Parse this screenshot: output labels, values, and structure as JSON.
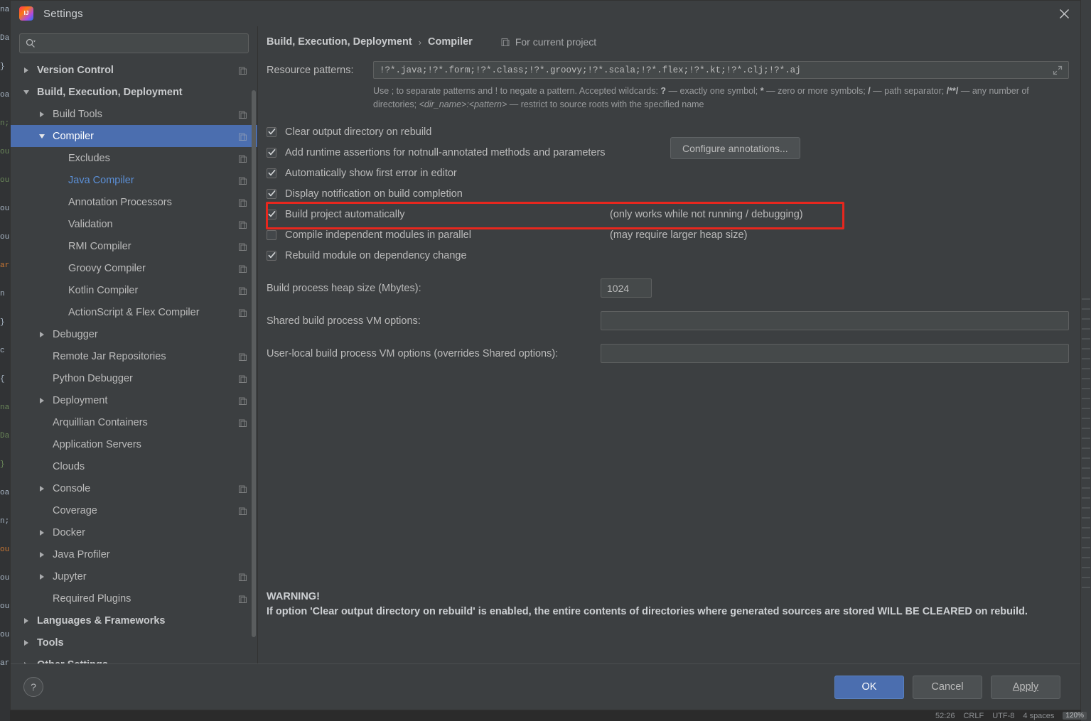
{
  "window": {
    "title": "Settings",
    "app_icon": "intellij-idea-icon",
    "close_icon": "close-icon"
  },
  "search": {
    "value": "",
    "placeholder": "",
    "icon": "search-icon"
  },
  "sidebar": {
    "scrollbar": "vertical-scrollbar",
    "items": [
      {
        "label": "Version Control",
        "level": 0,
        "twisty": "right",
        "bold": true,
        "selected": false,
        "link": false,
        "badge": true
      },
      {
        "label": "Build, Execution, Deployment",
        "level": 0,
        "twisty": "down",
        "bold": true,
        "selected": false,
        "link": false,
        "badge": false
      },
      {
        "label": "Build Tools",
        "level": 1,
        "twisty": "right",
        "bold": false,
        "selected": false,
        "link": false,
        "badge": true
      },
      {
        "label": "Compiler",
        "level": 1,
        "twisty": "down",
        "bold": false,
        "selected": true,
        "link": false,
        "badge": true
      },
      {
        "label": "Excludes",
        "level": 2,
        "twisty": "none",
        "bold": false,
        "selected": false,
        "link": false,
        "badge": true
      },
      {
        "label": "Java Compiler",
        "level": 2,
        "twisty": "none",
        "bold": false,
        "selected": false,
        "link": true,
        "badge": true
      },
      {
        "label": "Annotation Processors",
        "level": 2,
        "twisty": "none",
        "bold": false,
        "selected": false,
        "link": false,
        "badge": true
      },
      {
        "label": "Validation",
        "level": 2,
        "twisty": "none",
        "bold": false,
        "selected": false,
        "link": false,
        "badge": true
      },
      {
        "label": "RMI Compiler",
        "level": 2,
        "twisty": "none",
        "bold": false,
        "selected": false,
        "link": false,
        "badge": true
      },
      {
        "label": "Groovy Compiler",
        "level": 2,
        "twisty": "none",
        "bold": false,
        "selected": false,
        "link": false,
        "badge": true
      },
      {
        "label": "Kotlin Compiler",
        "level": 2,
        "twisty": "none",
        "bold": false,
        "selected": false,
        "link": false,
        "badge": true
      },
      {
        "label": "ActionScript & Flex Compiler",
        "level": 2,
        "twisty": "none",
        "bold": false,
        "selected": false,
        "link": false,
        "badge": true
      },
      {
        "label": "Debugger",
        "level": 1,
        "twisty": "right",
        "bold": false,
        "selected": false,
        "link": false,
        "badge": false
      },
      {
        "label": "Remote Jar Repositories",
        "level": 1,
        "twisty": "none",
        "bold": false,
        "selected": false,
        "link": false,
        "badge": true
      },
      {
        "label": "Python Debugger",
        "level": 1,
        "twisty": "none",
        "bold": false,
        "selected": false,
        "link": false,
        "badge": true
      },
      {
        "label": "Deployment",
        "level": 1,
        "twisty": "right",
        "bold": false,
        "selected": false,
        "link": false,
        "badge": true
      },
      {
        "label": "Arquillian Containers",
        "level": 1,
        "twisty": "none",
        "bold": false,
        "selected": false,
        "link": false,
        "badge": true
      },
      {
        "label": "Application Servers",
        "level": 1,
        "twisty": "none",
        "bold": false,
        "selected": false,
        "link": false,
        "badge": false
      },
      {
        "label": "Clouds",
        "level": 1,
        "twisty": "none",
        "bold": false,
        "selected": false,
        "link": false,
        "badge": false
      },
      {
        "label": "Console",
        "level": 1,
        "twisty": "right",
        "bold": false,
        "selected": false,
        "link": false,
        "badge": true
      },
      {
        "label": "Coverage",
        "level": 1,
        "twisty": "none",
        "bold": false,
        "selected": false,
        "link": false,
        "badge": true
      },
      {
        "label": "Docker",
        "level": 1,
        "twisty": "right",
        "bold": false,
        "selected": false,
        "link": false,
        "badge": false
      },
      {
        "label": "Java Profiler",
        "level": 1,
        "twisty": "right",
        "bold": false,
        "selected": false,
        "link": false,
        "badge": false
      },
      {
        "label": "Jupyter",
        "level": 1,
        "twisty": "right",
        "bold": false,
        "selected": false,
        "link": false,
        "badge": true
      },
      {
        "label": "Required Plugins",
        "level": 1,
        "twisty": "none",
        "bold": false,
        "selected": false,
        "link": false,
        "badge": true
      },
      {
        "label": "Languages & Frameworks",
        "level": 0,
        "twisty": "right",
        "bold": true,
        "selected": false,
        "link": false,
        "badge": false
      },
      {
        "label": "Tools",
        "level": 0,
        "twisty": "right",
        "bold": true,
        "selected": false,
        "link": false,
        "badge": false
      },
      {
        "label": "Other Settings",
        "level": 0,
        "twisty": "right",
        "bold": true,
        "selected": false,
        "link": false,
        "badge": false
      }
    ]
  },
  "content": {
    "breadcrumb": {
      "parent": "Build, Execution, Deployment",
      "separator": "›",
      "current": "Compiler",
      "scope_label": "For current project",
      "scope_icon": "project-scope-icon"
    },
    "resource_patterns": {
      "label": "Resource patterns:",
      "value": "!?*.java;!?*.form;!?*.class;!?*.groovy;!?*.scala;!?*.flex;!?*.kt;!?*.clj;!?*.aj",
      "expand_icon": "expand-icon"
    },
    "help_line_1_a": "Use ; to separate patterns and ! to negate a pattern. Accepted wildcards: ",
    "help_q": "?",
    "help_line_1_b": " — exactly one symbol; ",
    "help_star": "*",
    "help_line_1_c": " — zero or more symbols; ",
    "help_slash": "/",
    "help_line_1_d": " — path separator; ",
    "help_globstar": "/**/",
    "help_line_1_e": " — any number of directories; ",
    "help_dirname": "<dir_name>:<pattern>",
    "help_line_1_f": " — restrict to source roots with the specified name",
    "checkboxes": [
      {
        "label": "Clear output directory on rebuild",
        "mnemonic": "C",
        "checked": true,
        "note": ""
      },
      {
        "label": "Add runtime assertions for notnull-annotated methods and parameters",
        "mnemonic": "a",
        "checked": true,
        "note": ""
      },
      {
        "label": "Automatically show first error in editor",
        "mnemonic": "e",
        "checked": true,
        "note": ""
      },
      {
        "label": "Display notification on build completion",
        "mnemonic": "b",
        "checked": true,
        "note": ""
      },
      {
        "label": "Build project automatically",
        "mnemonic": "",
        "checked": true,
        "note": "(only works while not running / debugging)"
      },
      {
        "label": "Compile independent modules in parallel",
        "mnemonic": "",
        "checked": false,
        "note": "(may require larger heap size)"
      },
      {
        "label": "Rebuild module on dependency change",
        "mnemonic": "",
        "checked": true,
        "note": ""
      }
    ],
    "configure_annotations_button": "Configure annotations...",
    "fields": [
      {
        "label": "Build process heap size (Mbytes):",
        "value": "1024",
        "wide": false
      },
      {
        "label": "Shared build process VM options:",
        "value": "",
        "wide": true
      },
      {
        "label": "User-local build process VM options (overrides Shared options):",
        "value": "",
        "wide": true
      }
    ],
    "warning_title": "WARNING!",
    "warning_body": "If option 'Clear output directory on rebuild' is enabled, the entire contents of directories where generated sources are stored WILL BE CLEARED on rebuild.",
    "highlight_color": "#e8271e"
  },
  "footer": {
    "help_label": "?",
    "ok": "OK",
    "cancel": "Cancel",
    "apply": "Apply",
    "accent_color": "#4b6eaf"
  },
  "statusbar": {
    "position": "52:26",
    "line_separator": "CRLF",
    "encoding": "UTF-8",
    "indent": "4 spaces",
    "zoom": "120%"
  }
}
